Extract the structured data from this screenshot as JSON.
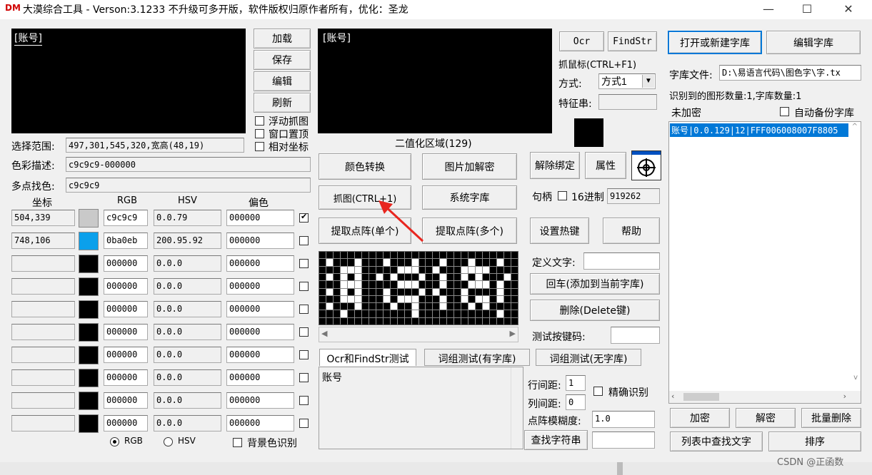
{
  "window": {
    "logo": "DM",
    "title": "大漠综合工具 - Verson:3.1233 不升级可多开版，软件版权归原作者所有，优化：圣龙",
    "min": "—",
    "max": "☐",
    "close": "✕"
  },
  "preview1_label": "[账号]",
  "preview2_label": "[账号]",
  "left_buttons": {
    "load": "加载",
    "save": "保存",
    "edit": "编辑",
    "refresh": "刷新"
  },
  "left_checks": {
    "float": "浮动抓图",
    "topmost": "窗口置顶",
    "relative": "相对坐标"
  },
  "select_range": {
    "label": "选择范围:",
    "value": "497,301,545,320,宽高(48,19)"
  },
  "color_desc": {
    "label": "色彩描述:",
    "value": "c9c9c9-000000"
  },
  "multi_find": {
    "label": "多点找色:",
    "value": "c9c9c9"
  },
  "color_table": {
    "headers": {
      "coord": "坐标",
      "rgb": "RGB",
      "hsv": "HSV",
      "offset": "偏色"
    },
    "rows": [
      {
        "coord": "504,339",
        "color": "#c9c9c9",
        "rgb": "c9c9c9",
        "hsv": "0.0.79",
        "offset": "000000",
        "checked": true
      },
      {
        "coord": "748,106",
        "color": "#0ba0eb",
        "rgb": "0ba0eb",
        "hsv": "200.95.92",
        "offset": "000000",
        "checked": false
      },
      {
        "coord": "",
        "color": "#000000",
        "rgb": "000000",
        "hsv": "0.0.0",
        "offset": "000000",
        "checked": false
      },
      {
        "coord": "",
        "color": "#000000",
        "rgb": "000000",
        "hsv": "0.0.0",
        "offset": "000000",
        "checked": false
      },
      {
        "coord": "",
        "color": "#000000",
        "rgb": "000000",
        "hsv": "0.0.0",
        "offset": "000000",
        "checked": false
      },
      {
        "coord": "",
        "color": "#000000",
        "rgb": "000000",
        "hsv": "0.0.0",
        "offset": "000000",
        "checked": false
      },
      {
        "coord": "",
        "color": "#000000",
        "rgb": "000000",
        "hsv": "0.0.0",
        "offset": "000000",
        "checked": false
      },
      {
        "coord": "",
        "color": "#000000",
        "rgb": "000000",
        "hsv": "0.0.0",
        "offset": "000000",
        "checked": false
      },
      {
        "coord": "",
        "color": "#000000",
        "rgb": "000000",
        "hsv": "0.0.0",
        "offset": "000000",
        "checked": false
      },
      {
        "coord": "",
        "color": "#000000",
        "rgb": "000000",
        "hsv": "0.0.0",
        "offset": "000000",
        "checked": false
      }
    ]
  },
  "mode_radios": {
    "rgb": "RGB",
    "hsv": "HSV",
    "bg": "背景色识别"
  },
  "binarize_label": "二值化区域(129)",
  "mid_buttons": {
    "color_convert": "颜色转换",
    "img_encrypt": "图片加解密",
    "capture": "抓图(CTRL+1)",
    "sys_lib": "系统字库",
    "extract_single": "提取点阵(单个)",
    "extract_multi": "提取点阵(多个)"
  },
  "tabs": [
    "Ocr和FindStr测试",
    "词组测试(有字库)",
    "词组测试(无字库)"
  ],
  "ocr_text": "账号",
  "right_mid": {
    "ocr": "Ocr",
    "findstr": "FindStr",
    "grab_mouse": "抓鼠标(CTRL+F1)",
    "mode_label": "方式:",
    "mode_value": "方式1",
    "feature_label": "特征串:",
    "unbind": "解除绑定",
    "props": "属性",
    "handle_label": "句柄",
    "hex_label": "16进制",
    "handle_value": "919262",
    "hotkey": "设置热键",
    "help": "帮助",
    "define_label": "定义文字:",
    "enter_add": "回车(添加到当前字库)",
    "delete": "删除(Delete键)",
    "test_key_label": "测试按键码:",
    "line_gap_label": "行间距:",
    "line_gap": "1",
    "col_gap_label": "列间距:",
    "col_gap": "0",
    "precise": "精确识别",
    "blur_label": "点阵模糊度:",
    "blur": "1.0",
    "find_string": "查找字符串"
  },
  "library": {
    "open_new": "打开或新建字库",
    "edit": "编辑字库",
    "file_label": "字库文件:",
    "file_path": "D:\\易语言代码\\图色字\\字.tx",
    "status": "识别到的图形数量:1,字库数量:1",
    "encrypt_state": "未加密",
    "auto_backup": "自动备份字库",
    "list_item": "账号|0.0.129|12|FFF006008007F8805",
    "encrypt": "加密",
    "decrypt": "解密",
    "batch_delete": "批量删除",
    "find_in_list": "列表中查找文字",
    "sort": "排序"
  },
  "watermark": "CSDN @正函数"
}
